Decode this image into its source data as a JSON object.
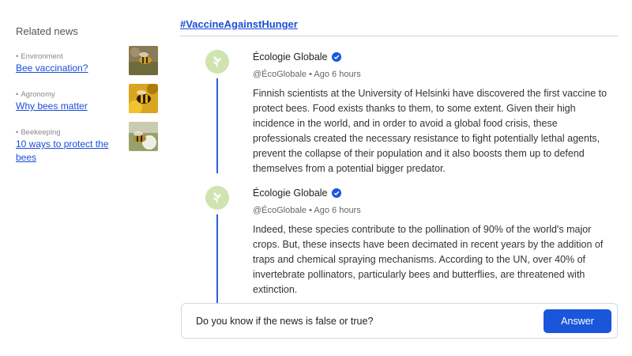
{
  "sidebar": {
    "title": "Related news",
    "items": [
      {
        "category": "Environment",
        "link": "Bee vaccination?",
        "thumb_icon": "bee-on-flower-photo"
      },
      {
        "category": "Agronomy",
        "link": "Why bees matter",
        "thumb_icon": "bee-on-yellow-flower-photo"
      },
      {
        "category": "Beekeeping",
        "link": "10 ways to protect the bees",
        "thumb_icon": "bee-on-white-flower-photo"
      }
    ]
  },
  "main": {
    "hashtag": "#VaccineAgainstHunger",
    "posts": [
      {
        "author": "Écologie Globale",
        "handle": "@ÉcoGlobale",
        "time": "Ago 6 hours",
        "text": "Finnish scientists at the University of Helsinki have discovered the first vaccine to protect bees. Food exists thanks to them, to some extent. Given their high incidence in the world, and in order to avoid a global food crisis, these professionals created the necessary resistance to fight potentially lethal agents, prevent the collapse of their population and it also boosts them up to defend themselves from a potential bigger predator."
      },
      {
        "author": "Écologie Globale",
        "handle": "@ÉcoGlobale",
        "time": "Ago 6 hours",
        "text": "Indeed, these species contribute to the pollination of 90% of the world's major crops. But, these insects have been decimated in recent years by the addition of traps and chemical spraying mechanisms. According to the UN, over 40% of invertebrate pollinators, particularly bees and butterflies, are threatened with extinction."
      }
    ]
  },
  "question": {
    "text": "Do you know if the news is false or true?",
    "button": "Answer"
  },
  "colors": {
    "accent": "#1a56db",
    "link": "#1a4ed8",
    "avatar_bg": "#cfe4b0"
  }
}
